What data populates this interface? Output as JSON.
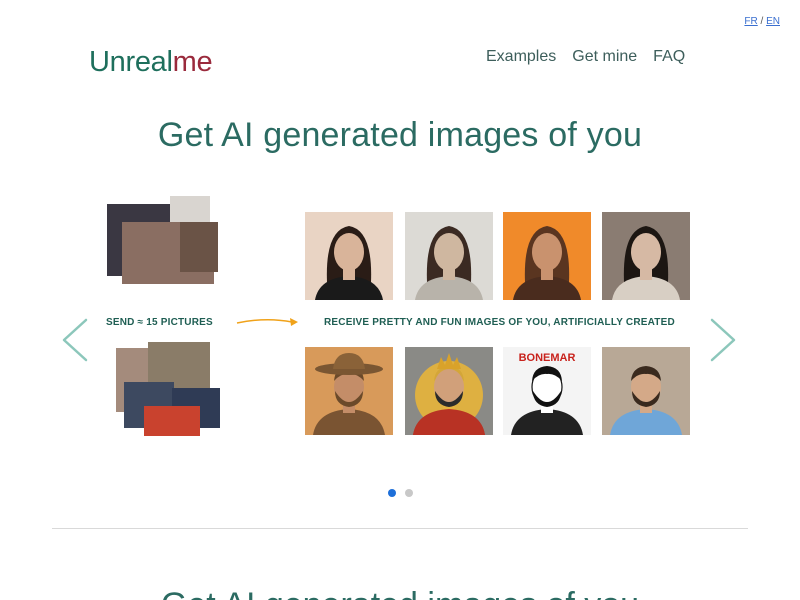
{
  "lang": {
    "fr": "FR",
    "sep": "/",
    "en": "EN"
  },
  "logo": {
    "part1": "Unreal",
    "part2": "me"
  },
  "nav": {
    "examples": "Examples",
    "get_mine": "Get mine",
    "faq": "FAQ"
  },
  "hero": {
    "title": "Get AI generated images of you"
  },
  "carousel": {
    "send_label": "SEND ≈ 15 PICTURES",
    "receive_label": "RECEIVE PRETTY AND FUN IMAGES OF YOU, ARTIFICIALLY CREATED",
    "prev_icon": "chevron-left-icon",
    "next_icon": "chevron-right-icon",
    "tiles_top": [
      {
        "name": "woman-portrait-black-top",
        "bg": "#e9d4c4",
        "hair": "#2a1c16",
        "skin": "#d9b49a",
        "cloth": "#1a1a1a"
      },
      {
        "name": "woman-portrait-metal-armor",
        "bg": "#dcdad5",
        "hair": "#3b2a22",
        "skin": "#cfb7a0",
        "cloth": "#b8b3aa"
      },
      {
        "name": "woman-portrait-orange",
        "bg": "#f08a2a",
        "hair": "#5a3520",
        "skin": "#c9926e",
        "cloth": "#4a2c1e"
      },
      {
        "name": "woman-portrait-grey",
        "bg": "#8a7c72",
        "hair": "#1c1612",
        "skin": "#d6b9a4",
        "cloth": "#d8cfc4"
      }
    ],
    "tiles_bottom": [
      {
        "name": "man-portrait-cowboy",
        "bg": "#d89a5a",
        "hair": "#6b4a2a",
        "skin": "#c48d68",
        "cloth": "#7a5432"
      },
      {
        "name": "man-portrait-king-emblem",
        "bg": "#8a8a86",
        "hair": "#2b2b2b",
        "skin": "#d1a07a",
        "cloth": "#b83224"
      },
      {
        "name": "man-portrait-coloring-book",
        "bg": "#f4f4f4",
        "hair": "#111111",
        "skin": "#ffffff",
        "cloth": "#222222"
      },
      {
        "name": "man-portrait-blue-suit",
        "bg": "#b8a896",
        "hair": "#3a2a1e",
        "skin": "#d4a988",
        "cloth": "#6fa6d8"
      }
    ],
    "coloring_text": "BONEMAR",
    "dots": [
      {
        "active": true
      },
      {
        "active": false
      }
    ]
  },
  "section2": {
    "title": "Get AI generated images of you"
  },
  "colors": {
    "accent": "#2b6b62",
    "logo_red": "#9a2a3c",
    "dot_active": "#1e6fd9",
    "arrow": "#8cc7bb"
  }
}
